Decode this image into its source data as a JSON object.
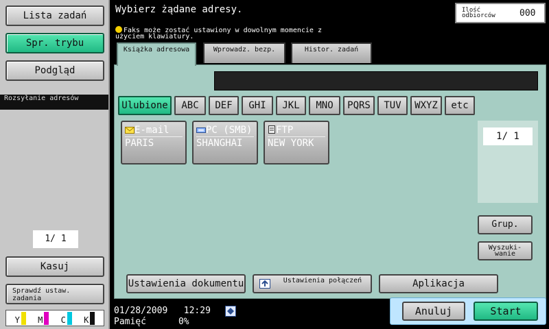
{
  "left_panel": {
    "job_list": "Lista zadań",
    "mode_check": "Spr. trybu",
    "preview": "Podgląd",
    "broadcast": "Rozsyłanie adresów",
    "pager": "1/  1",
    "delete": "Kasuj",
    "check_job_settings": "Sprawdź ustaw. zadania",
    "toner": [
      {
        "letter": "Y",
        "color": "#f0e000"
      },
      {
        "letter": "M",
        "color": "#e000c0"
      },
      {
        "letter": "C",
        "color": "#00c8e0"
      },
      {
        "letter": "K",
        "color": "#111111"
      }
    ]
  },
  "header": {
    "title": "Wybierz żądane adresy.",
    "hint": "Faks może zostać ustawiony w dowolnym momencie z użyciem klawiatury.",
    "recipients_label": "Ilość odbiorców",
    "recipients_count": "000"
  },
  "tabs": {
    "address_book": "Książka adresowa",
    "direct_input": "Wprowadz. bezp.",
    "job_history": "Histor. zadań"
  },
  "index_tabs": [
    "Ulubione",
    "ABC",
    "DEF",
    "GHI",
    "JKL",
    "MNO",
    "PQRS",
    "TUV",
    "WXYZ",
    "etc"
  ],
  "destinations": [
    {
      "type": "E-mail",
      "name": "PARIS",
      "icon": "envelope-icon"
    },
    {
      "type": "PC (SMB)",
      "name": "SHANGHAI",
      "icon": "pc-icon"
    },
    {
      "type": "FTP",
      "name": "NEW YORK",
      "icon": "ftp-icon"
    }
  ],
  "page_indicator": "1/   1",
  "side_buttons": {
    "group": "Grup.",
    "search": "Wyszuki- wanie"
  },
  "bottom_buttons": {
    "document_settings": "Ustawienia dokumentu",
    "connection_settings": "Ustawienia połączeń",
    "application": "Aplikacja"
  },
  "status": {
    "date": "01/28/2009",
    "time": "12:29",
    "memory_label": "Pamięć",
    "memory_value": "0%"
  },
  "actions": {
    "cancel": "Anuluj",
    "start": "Start"
  }
}
